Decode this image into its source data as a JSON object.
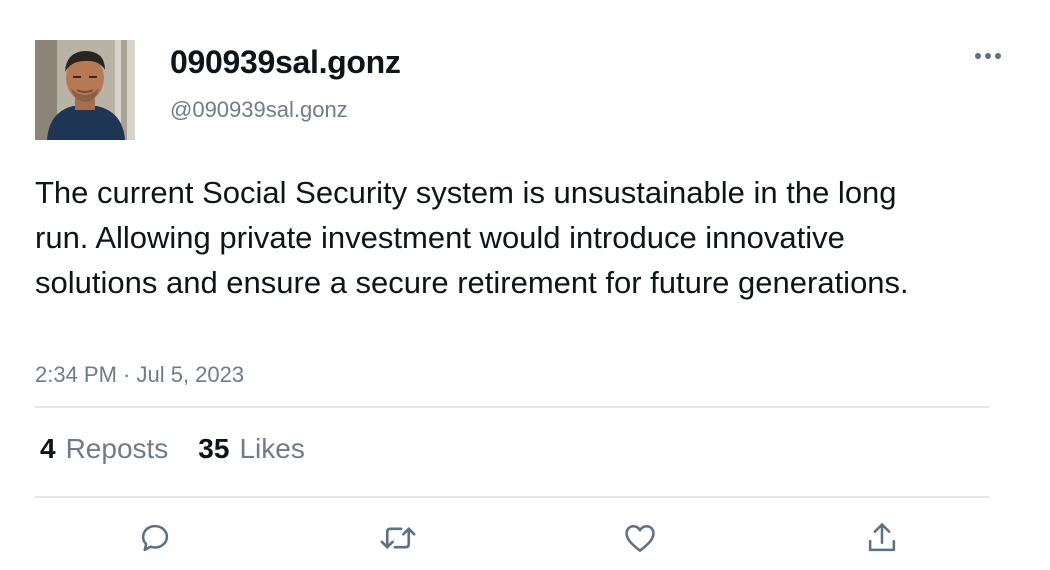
{
  "post": {
    "author": {
      "display_name": "090939sal.gonz",
      "handle": "@090939sal.gonz",
      "avatar_icon": "profile-photo"
    },
    "text": "The current Social Security system is unsustainable in the long run. Allowing private investment would introduce innovative solutions and ensure a secure retirement for future generations.",
    "timestamp": "2:34 PM · Jul 5, 2023",
    "stats": {
      "reposts_count": "4",
      "reposts_label": "Reposts",
      "likes_count": "35",
      "likes_label": "Likes"
    },
    "actions": {
      "reply_icon": "speech-bubble-icon",
      "repost_icon": "repost-arrows-icon",
      "like_icon": "heart-outline-icon",
      "share_icon": "share-upload-icon"
    },
    "more_icon": "ellipsis-icon"
  },
  "colors": {
    "text_primary": "#0f1419",
    "text_secondary": "#6e7c8a",
    "divider": "#e3e6e8",
    "icon": "#5b7083"
  }
}
